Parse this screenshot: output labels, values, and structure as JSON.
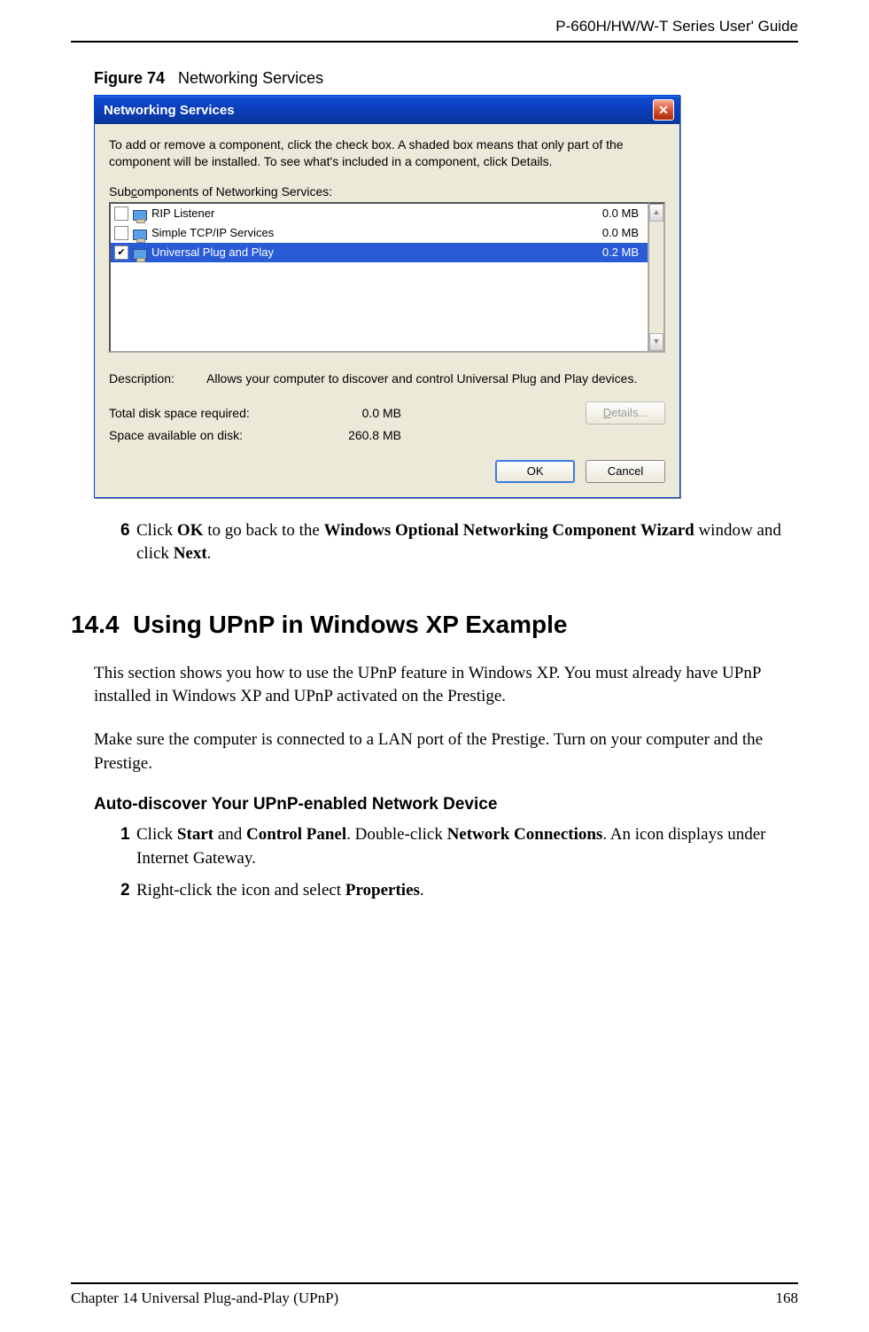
{
  "header": {
    "guide_title": "P-660H/HW/W-T Series User' Guide"
  },
  "figure": {
    "label": "Figure 74",
    "title": "Networking Services"
  },
  "dialog": {
    "title": "Networking Services",
    "intro": "To add or remove a component, click the check box. A shaded box means that only part of the component will be installed. To see what's included in a component, click Details.",
    "sub_label_prefix": "Sub",
    "sub_label_underlined": "c",
    "sub_label_suffix": "omponents of Networking Services:",
    "items": [
      {
        "checked": false,
        "label": "RIP Listener",
        "size": "0.0 MB",
        "selected": false
      },
      {
        "checked": false,
        "label": "Simple TCP/IP Services",
        "size": "0.0 MB",
        "selected": false
      },
      {
        "checked": true,
        "label": "Universal Plug and Play",
        "size": "0.2 MB",
        "selected": true
      }
    ],
    "description_label": "Description:",
    "description_text": "Allows your computer to discover and control Universal Plug and Play devices.",
    "total_label": "Total disk space required:",
    "total_value": "0.0 MB",
    "avail_label": "Space available on disk:",
    "avail_value": "260.8 MB",
    "details_btn_underlined": "D",
    "details_btn_suffix": "etails...",
    "ok_btn": "OK",
    "cancel_btn": "Cancel"
  },
  "step6": {
    "num": "6",
    "text_before_ok": "Click ",
    "ok": "OK",
    "text_mid": " to go back to the ",
    "wiz": "Windows Optional Networking Component Wizard",
    "text_after": " window and click ",
    "next": "Next",
    "period": "."
  },
  "section": {
    "number": "14.4",
    "title": "Using UPnP in Windows XP Example",
    "para1": "This section shows you how to use the UPnP feature in Windows XP. You must already have UPnP installed in Windows XP and UPnP activated on the Prestige.",
    "para2": "Make sure the computer is connected to a LAN port of the Prestige. Turn on your computer and the Prestige.",
    "subheading": "Auto-discover Your UPnP-enabled Network Device",
    "step1": {
      "num": "1",
      "t1": "Click ",
      "b1": "Start",
      "t2": " and ",
      "b2": "Control Panel",
      "t3": ". Double-click ",
      "b3": "Network Connections",
      "t4": ". An icon displays under Internet Gateway."
    },
    "step2": {
      "num": "2",
      "t1": "Right-click the icon and select ",
      "b1": "Properties",
      "t2": "."
    }
  },
  "footer": {
    "chapter": "Chapter 14 Universal Plug-and-Play (UPnP)",
    "page": "168"
  }
}
